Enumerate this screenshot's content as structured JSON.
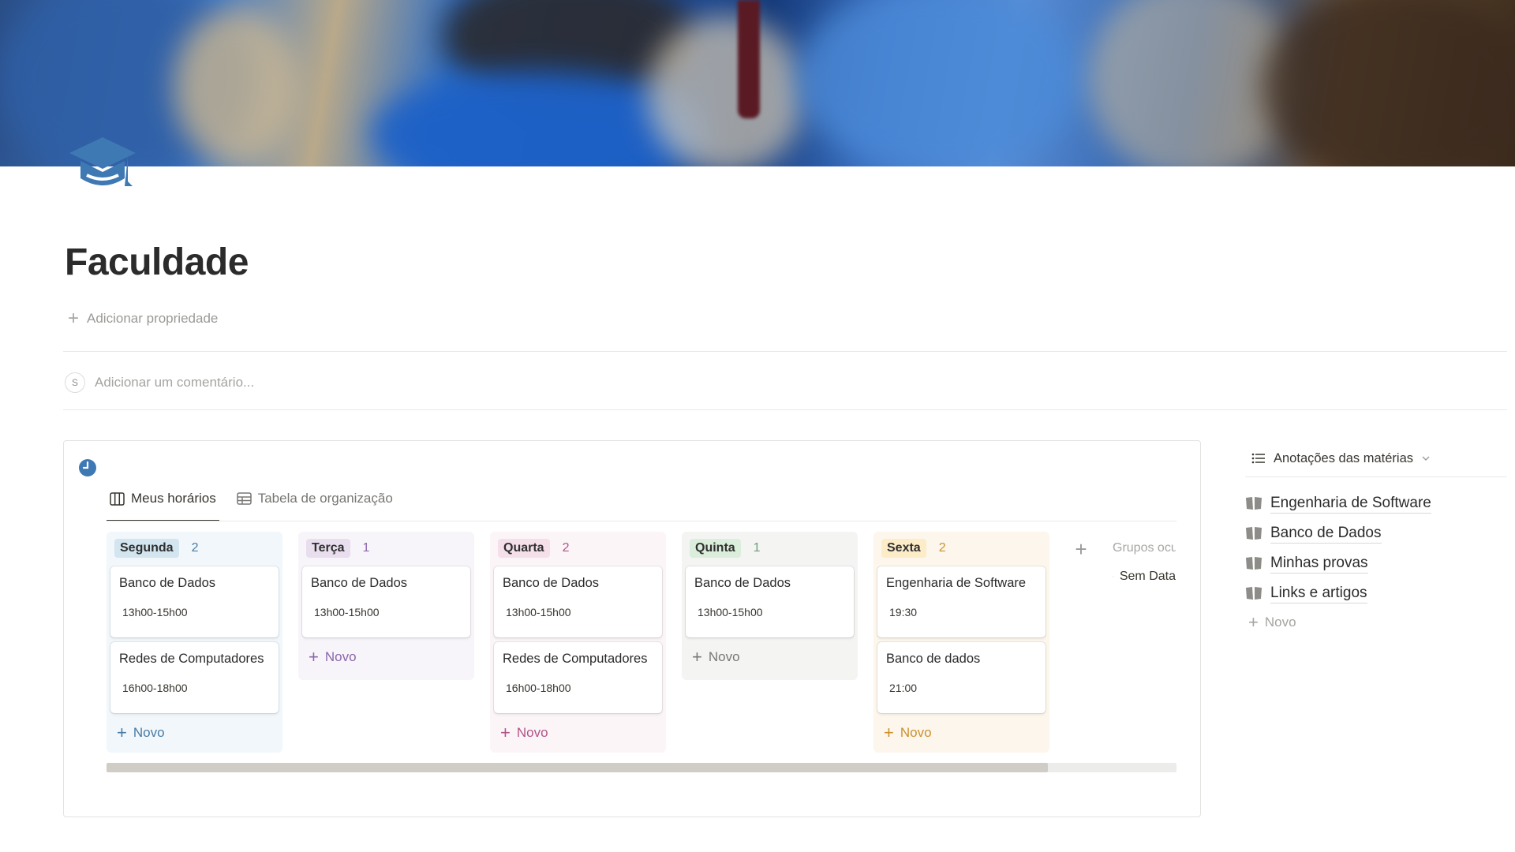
{
  "page": {
    "title": "Faculdade"
  },
  "properties": {
    "add_label": "Adicionar propriedade"
  },
  "comment": {
    "avatar_initial": "S",
    "placeholder": "Adicionar um comentário..."
  },
  "board": {
    "tabs": [
      {
        "label": "Meus horários",
        "icon": "board-icon",
        "active": true
      },
      {
        "label": "Tabela de organização",
        "icon": "table-icon",
        "active": false
      }
    ],
    "columns": [
      {
        "name": "Segunda",
        "count": "2",
        "pill_bg": "#d3e5ef",
        "col_bg": "#f1f7fb",
        "accent": "#487ca5",
        "cards": [
          {
            "title": "Banco de Dados",
            "time": "13h00-15h00"
          },
          {
            "title": "Redes de Computadores",
            "time": "16h00-18h00"
          }
        ]
      },
      {
        "name": "Terça",
        "count": "1",
        "pill_bg": "#e8deee",
        "col_bg": "#f8f5fa",
        "accent": "#8a67ab",
        "cards": [
          {
            "title": "Banco de Dados",
            "time": "13h00-15h00"
          }
        ]
      },
      {
        "name": "Quarta",
        "count": "2",
        "pill_bg": "#f5e0e9",
        "col_bg": "#fbf5f8",
        "accent": "#b35488",
        "cards": [
          {
            "title": "Banco de Dados",
            "time": "13h00-15h00"
          },
          {
            "title": "Redes de Computadores",
            "time": "16h00-18h00"
          }
        ]
      },
      {
        "name": "Quinta",
        "count": "1",
        "pill_bg": "#dbeddb",
        "col_bg": "#f4f5f3",
        "accent": "#6c9b7d",
        "cards": [
          {
            "title": "Banco de Dados",
            "time": "13h00-15h00"
          }
        ]
      },
      {
        "name": "Sexta",
        "count": "2",
        "pill_bg": "#fdecc8",
        "col_bg": "#fcf6ec",
        "accent": "#cb912f",
        "cards": [
          {
            "title": "Engenharia de Software",
            "time": "19:30"
          },
          {
            "title": "Banco de dados",
            "time": "21:00"
          }
        ]
      }
    ],
    "new_label": "Novo",
    "add_group_icon": "plus-icon",
    "hidden_groups_label": "Grupos ocultos",
    "hidden_group_item": "Sem Data",
    "scroll_progress": 0.88
  },
  "sidebar": {
    "title": "Anotações das matérias",
    "items": [
      {
        "label": "Engenharia de Software",
        "icon": "book-icon"
      },
      {
        "label": "Banco de Dados",
        "icon": "book-icon"
      },
      {
        "label": "Minhas provas",
        "icon": "book-icon"
      },
      {
        "label": "Links e artigos",
        "icon": "book-icon"
      }
    ],
    "new_label": "Novo"
  },
  "colors": {
    "icon_blue": "#3f79b4",
    "text": "#37352f",
    "muted": "#9b9a97"
  }
}
